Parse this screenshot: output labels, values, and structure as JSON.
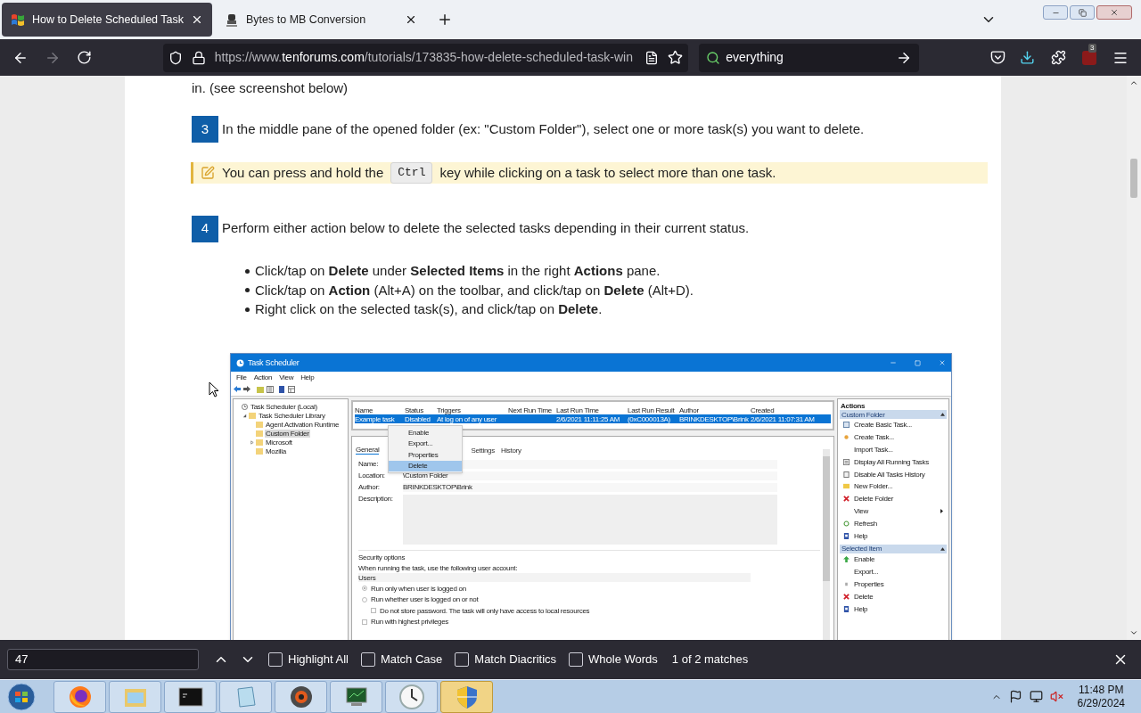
{
  "browser": {
    "tabs": [
      {
        "title": "How to Delete Scheduled Task",
        "selected": true
      },
      {
        "title": "Bytes to MB Conversion",
        "selected": false
      }
    ],
    "url": {
      "prefix": "https://www.",
      "domain": "tenforums.com",
      "path": "/tutorials/173835-how-delete-scheduled-task-win"
    },
    "search_text": "everything",
    "extension_badge": "3"
  },
  "article": {
    "intro": "in. (see screenshot below)",
    "blocks": [
      {
        "kind": "step",
        "number": "3",
        "text": "In the middle pane of the opened folder (ex: \"Custom Folder\"), select one or more task(s) you want to delete."
      },
      {
        "kind": "tip",
        "before": "You can press and hold the",
        "key": "Ctrl",
        "after": "key while clicking on a task to select more than one task."
      },
      {
        "kind": "step",
        "number": "4",
        "text": "Perform either action below to delete the selected tasks depending in their current status."
      },
      {
        "kind": "bullets",
        "items": [
          "Click/tap on **Delete** under **Selected Items** in the right **Actions** pane.",
          "Click/tap on **Action** (Alt+A) on the toolbar, and click/tap on **Delete** (Alt+D).",
          "Right click on the selected task(s), and click/tap on **Delete**."
        ]
      }
    ],
    "screenshot": {
      "title": "Task Scheduler",
      "menu": [
        "File",
        "Action",
        "View",
        "Help"
      ],
      "tree": [
        {
          "label": "Task Scheduler (Local)",
          "selected": false,
          "children": [
            {
              "label": "Task Scheduler Library",
              "selected": false,
              "expanded": true,
              "children": [
                {
                  "label": "Agent Activation Runtime",
                  "selected": false
                },
                {
                  "label": "Custom Folder",
                  "selected": true
                },
                {
                  "label": "Microsoft",
                  "selected": false,
                  "expanded": false
                },
                {
                  "label": "Mozilla",
                  "selected": false
                }
              ]
            }
          ]
        }
      ],
      "columns": [
        "Name",
        "Status",
        "Triggers",
        "Next Run Time",
        "Last Run Time",
        "Last Run Result",
        "Author",
        "Created"
      ],
      "rows": [
        {
          "selected": true,
          "name": "Example task",
          "status": "Disabled",
          "triggers": "At log on of any user",
          "last_run_time": "2/6/2021 11:11:25 AM",
          "last_run_result": "(0xC000013A)",
          "author": "BRINKDESKTOP\\Brink",
          "created": "2/6/2021 11:07:31 AM"
        }
      ],
      "context_menu": [
        {
          "label": "Enable",
          "selected": false
        },
        {
          "label": "Export...",
          "selected": false
        },
        {
          "label": "Properties",
          "selected": false
        },
        {
          "label": "Delete",
          "selected": true
        }
      ],
      "detail_tabs": [
        {
          "label": "General",
          "selected": true
        },
        {
          "label": "Settings",
          "selected": false
        },
        {
          "label": "History",
          "selected": false
        }
      ],
      "fields": [
        {
          "kind": "text",
          "label": "Name:"
        },
        {
          "kind": "text",
          "label": "Location:",
          "value": "\\Custom Folder"
        },
        {
          "kind": "text",
          "label": "Author:",
          "value": "BRINKDESKTOP\\Brink"
        },
        {
          "kind": "area",
          "label": "Description:"
        }
      ],
      "security": {
        "heading": "Security options",
        "prompt": "When running the task, use the following user account:",
        "account": "Users",
        "options": [
          {
            "kind": "radio",
            "label": "Run only when user is logged on",
            "checked": true
          },
          {
            "kind": "radio",
            "label": "Run whether user is logged on or not",
            "checked": false,
            "children": [
              {
                "kind": "checkbox",
                "label": "Do not store password.  The task will only have access to local resources",
                "checked": false
              }
            ]
          },
          {
            "kind": "checkbox",
            "label": "Run with highest privileges",
            "checked": false
          }
        ]
      },
      "actions": {
        "heading": "Actions",
        "sections": [
          {
            "title": "Custom Folder",
            "items": [
              {
                "kind": "basic-task",
                "label": "Create Basic Task..."
              },
              {
                "kind": "task",
                "label": "Create Task..."
              },
              {
                "kind": "none",
                "label": "Import Task..."
              },
              {
                "kind": "list",
                "label": "Display All Running Tasks"
              },
              {
                "kind": "history",
                "label": "Disable All Tasks History"
              },
              {
                "kind": "folder",
                "label": "New Folder..."
              },
              {
                "kind": "delete",
                "label": "Delete Folder"
              },
              {
                "kind": "submenu",
                "label": "View"
              },
              {
                "kind": "refresh",
                "label": "Refresh"
              },
              {
                "kind": "help",
                "label": "Help"
              }
            ]
          },
          {
            "title": "Selected Item",
            "items": [
              {
                "kind": "enable",
                "label": "Enable"
              },
              {
                "kind": "none",
                "label": "Export..."
              },
              {
                "kind": "properties",
                "label": "Properties"
              },
              {
                "kind": "delete",
                "label": "Delete"
              },
              {
                "kind": "help",
                "label": "Help"
              }
            ]
          }
        ]
      }
    }
  },
  "find_bar": {
    "value": "47",
    "options": [
      {
        "label": "Highlight All",
        "checked": false
      },
      {
        "label": "Match Case",
        "checked": false
      },
      {
        "label": "Match Diacritics",
        "checked": false
      },
      {
        "label": "Whole Words",
        "checked": false
      }
    ],
    "status": "1 of 2 matches"
  },
  "taskbar": {
    "apps": [
      {
        "kind": "firefox",
        "selected": false
      },
      {
        "kind": "explorer",
        "selected": false
      },
      {
        "kind": "terminal",
        "selected": false
      },
      {
        "kind": "notepad",
        "selected": false
      },
      {
        "kind": "media",
        "selected": false
      },
      {
        "kind": "monitor",
        "selected": false
      },
      {
        "kind": "clock",
        "selected": false
      },
      {
        "kind": "shield",
        "selected": true
      }
    ],
    "time": "11:48 PM",
    "date": "6/29/2024"
  }
}
